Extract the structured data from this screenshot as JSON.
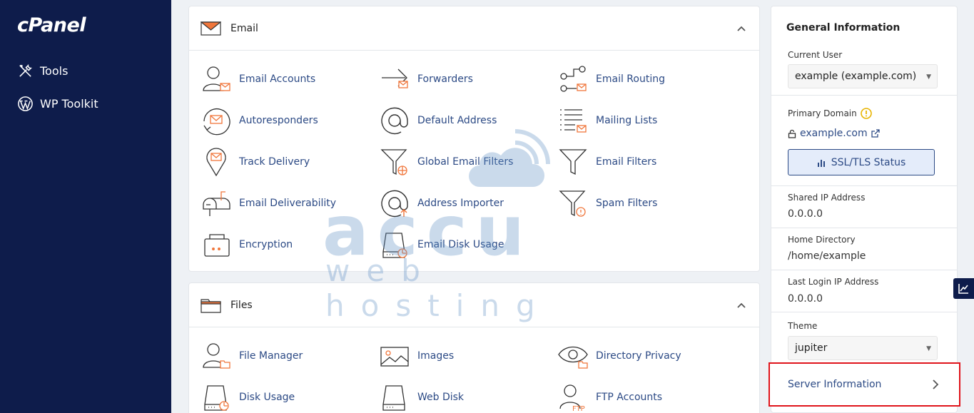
{
  "sidebar": {
    "logo": "cPanel",
    "items": [
      {
        "label": "Tools",
        "icon": "tools-icon"
      },
      {
        "label": "WP Toolkit",
        "icon": "wordpress-icon"
      }
    ]
  },
  "email_panel": {
    "title": "Email",
    "items": [
      {
        "label": "Email Accounts",
        "icon": "email-accounts-icon"
      },
      {
        "label": "Forwarders",
        "icon": "forwarders-icon"
      },
      {
        "label": "Email Routing",
        "icon": "email-routing-icon"
      },
      {
        "label": "Autoresponders",
        "icon": "autoresponders-icon"
      },
      {
        "label": "Default Address",
        "icon": "default-address-icon"
      },
      {
        "label": "Mailing Lists",
        "icon": "mailing-lists-icon"
      },
      {
        "label": "Track Delivery",
        "icon": "track-delivery-icon"
      },
      {
        "label": "Global Email Filters",
        "icon": "global-email-filters-icon"
      },
      {
        "label": "Email Filters",
        "icon": "email-filters-icon"
      },
      {
        "label": "Email Deliverability",
        "icon": "email-deliverability-icon"
      },
      {
        "label": "Address Importer",
        "icon": "address-importer-icon"
      },
      {
        "label": "Spam Filters",
        "icon": "spam-filters-icon"
      },
      {
        "label": "Encryption",
        "icon": "encryption-icon"
      },
      {
        "label": "Email Disk Usage",
        "icon": "email-disk-usage-icon"
      }
    ]
  },
  "files_panel": {
    "title": "Files",
    "items": [
      {
        "label": "File Manager",
        "icon": "file-manager-icon"
      },
      {
        "label": "Images",
        "icon": "images-icon"
      },
      {
        "label": "Directory Privacy",
        "icon": "directory-privacy-icon"
      },
      {
        "label": "Disk Usage",
        "icon": "disk-usage-icon"
      },
      {
        "label": "Web Disk",
        "icon": "web-disk-icon"
      },
      {
        "label": "FTP Accounts",
        "icon": "ftp-accounts-icon"
      }
    ]
  },
  "watermark": {
    "word": "accu",
    "sub": "web hosting"
  },
  "general_info": {
    "title": "General Information",
    "current_user_label": "Current User",
    "current_user_value": "example (example.com)",
    "primary_domain_label": "Primary Domain",
    "primary_domain_value": "example.com",
    "ssl_button": "SSL/TLS Status",
    "shared_ip_label": "Shared IP Address",
    "shared_ip_value": "0.0.0.0",
    "home_dir_label": "Home Directory",
    "home_dir_value": "/home/example",
    "last_login_label": "Last Login IP Address",
    "last_login_value": "0.0.0.0",
    "theme_label": "Theme",
    "theme_value": "jupiter",
    "server_info_link": "Server Information"
  },
  "colors": {
    "sidebar_bg": "#0e1c4b",
    "link": "#2c4a85",
    "accent_orange": "#f0763b",
    "highlight_red": "#e0141b"
  }
}
